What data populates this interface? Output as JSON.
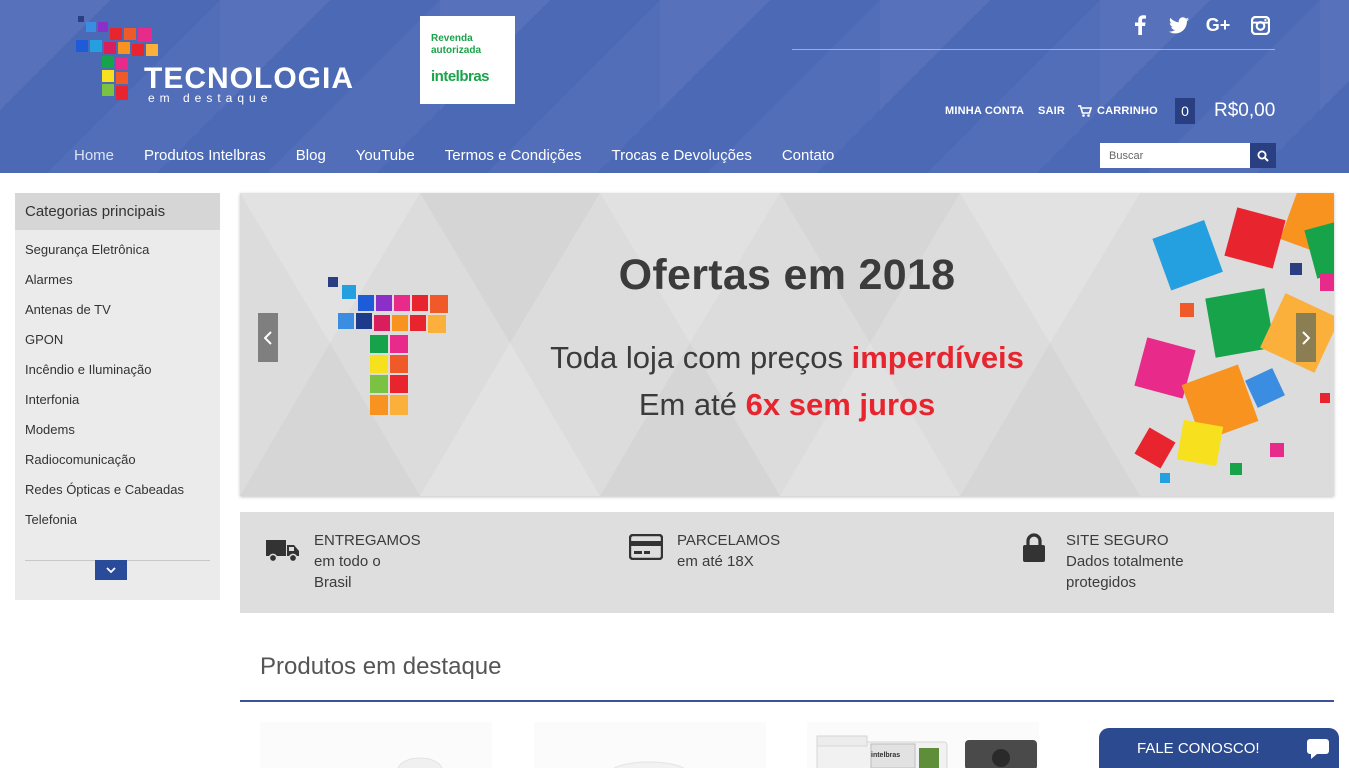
{
  "header": {
    "logo": {
      "word": "TECNOLOGIA",
      "sub": "em destaque"
    },
    "badge": {
      "top": "Revenda autorizada",
      "brand": "intelbras"
    },
    "social": [
      "facebook-icon",
      "twitter-icon",
      "google-plus-icon",
      "instagram-icon"
    ],
    "social_glyphs": {
      "facebook": "f",
      "twitter": "🐦",
      "gplus": "G+",
      "instagram": "◘"
    },
    "account": {
      "my_account": "MINHA CONTA",
      "logout": "SAIR",
      "cart": "CARRINHO",
      "cart_count": "0",
      "cart_total": "R$0,00"
    },
    "nav": [
      "Home",
      "Produtos Intelbras",
      "Blog",
      "YouTube",
      "Termos e Condições",
      "Trocas e Devoluções",
      "Contato"
    ],
    "search": {
      "placeholder": "Buscar"
    }
  },
  "sidebar": {
    "title": "Categorias principais",
    "items": [
      "Segurança Eletrônica",
      "Alarmes",
      "Antenas de TV",
      "GPON",
      "Incêndio e Iluminação",
      "Interfonia",
      "Modems",
      "Radiocomunicação",
      "Redes Ópticas e Cabeadas",
      "Telefonia"
    ]
  },
  "banner": {
    "title": "Ofertas em 2018",
    "line1_a": "Toda loja com preços ",
    "line1_b": "imperdíveis",
    "line2_a": "Em até ",
    "line2_b": "6x sem juros"
  },
  "features": [
    {
      "title": "ENTREGAMOS",
      "desc": "em todo o Brasil",
      "icon": "truck-icon"
    },
    {
      "title": "PARCELAMOS",
      "desc": "em até 18X",
      "icon": "credit-card-icon"
    },
    {
      "title": "SITE SEGURO",
      "desc": "Dados totalmente protegidos",
      "icon": "lock-icon"
    }
  ],
  "products": {
    "title": "Produtos em destaque",
    "thumb_brand": "intelbras"
  },
  "chat": {
    "label": "FALE CONOSCO!"
  },
  "colors": {
    "header": "#4c69b6",
    "dark_blue": "#2a3f82",
    "accent_red": "#e8242e",
    "badge_green": "#1aa34a"
  }
}
